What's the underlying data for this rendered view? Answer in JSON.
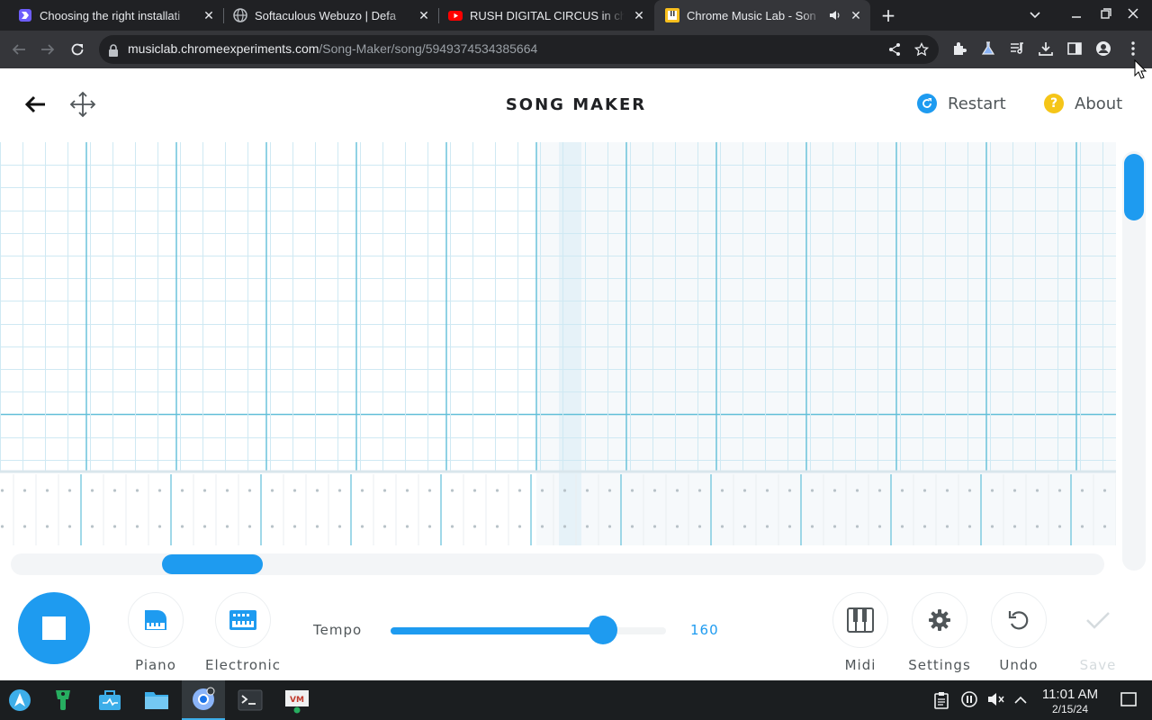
{
  "browser": {
    "tabs": [
      {
        "title": "Choosing the right installati",
        "favicon": "softaculous-icon",
        "active": false
      },
      {
        "title": "Softaculous Webuzo | Defa",
        "favicon": "globe-icon",
        "active": false
      },
      {
        "title": "RUSH DIGITAL CIRCUS in ch",
        "favicon": "youtube-icon",
        "active": false
      },
      {
        "title": "Chrome Music Lab - Son",
        "favicon": "music-lab-icon",
        "active": true,
        "audio": true
      }
    ],
    "url_host": "musiclab.chromeexperiments.com",
    "url_path": "/Song-Maker/song/5949374534385664"
  },
  "app": {
    "title": "SONG MAKER",
    "restart_label": "Restart",
    "about_label": "About",
    "tools": {
      "piano_label": "Piano",
      "electronic_label": "Electronic",
      "midi_label": "Midi",
      "settings_label": "Settings",
      "undo_label": "Undo",
      "save_label": "Save"
    },
    "tempo": {
      "label": "Tempo",
      "value": "160",
      "slider_fraction": 0.77
    },
    "colors": {
      "accent": "#1e9bf0",
      "about": "#f5c518",
      "grid_line": "#cfe9f3",
      "grid_bar": "#62bfd8"
    }
  },
  "taskbar": {
    "time": "11:01 AM",
    "date": "2/15/24"
  }
}
